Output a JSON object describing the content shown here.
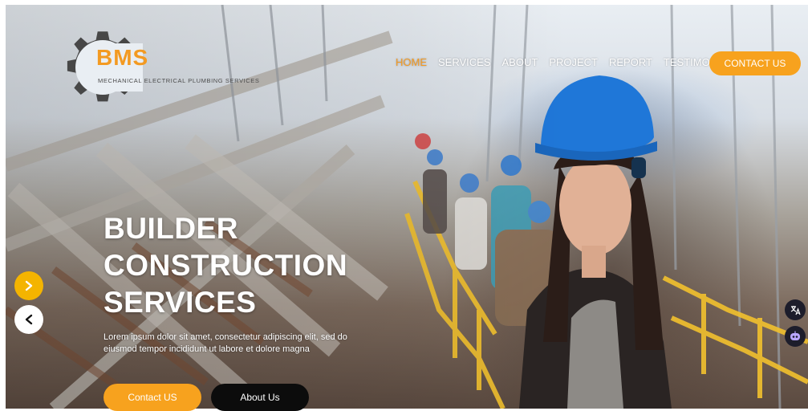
{
  "logo": {
    "brand": "BMS",
    "tagline": "MECHANICAL ELECTRICAL PLUMBING SERVICES"
  },
  "nav": {
    "items": [
      {
        "label": "HOME",
        "active": true
      },
      {
        "label": "SERVICES",
        "active": false
      },
      {
        "label": "ABOUT",
        "active": false
      },
      {
        "label": "PROJECT",
        "active": false
      },
      {
        "label": "REPORT",
        "active": false
      },
      {
        "label": "TESTIMONIAL",
        "active": false
      }
    ],
    "contact_label": "CONTACT US"
  },
  "hero": {
    "headline": [
      "BUILDER",
      "CONSTRUCTION",
      "SERVICES"
    ],
    "description": "Lorem ipsum dolor sit amet, consectetur adipiscing elit, sed do eiusmod tempor incididunt ut labore et dolore magna",
    "primary_button": "Contact US",
    "secondary_button": "About Us"
  },
  "slider": {
    "next_icon": "chevron-right-icon",
    "prev_icon": "chevron-left-icon"
  },
  "widgets": {
    "translate_icon": "translate-icon",
    "chatbot_icon": "chatbot-icon"
  },
  "colors": {
    "accent": "#f7a21e",
    "arrow_accent": "#f4b400",
    "dark_button": "#0c0c0c"
  }
}
